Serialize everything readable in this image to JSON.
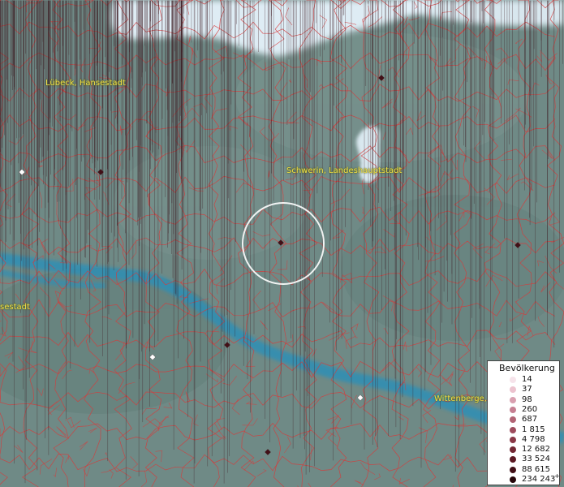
{
  "map": {
    "colors": {
      "land": "#6f8a86",
      "water": "#2f8fb5",
      "ice": "#e4f2fa",
      "boundary": "#d83a3a",
      "focus_ring": "#ffffff"
    },
    "labels": [
      {
        "id": "luebeck",
        "text": "Lübeck, Hansestadt"
      },
      {
        "id": "schwerin",
        "text": "Schwerin, Landeshauptstadt"
      },
      {
        "id": "hansestadt-left",
        "text": "sestadt"
      },
      {
        "id": "wittenberge",
        "text": "Wittenberge,"
      }
    ],
    "legend": {
      "title": "Bevölkerung",
      "entries": [
        {
          "value": "14",
          "color": "#f6e3ea"
        },
        {
          "value": "37",
          "color": "#ecc3cf"
        },
        {
          "value": "98",
          "color": "#d9a0b0"
        },
        {
          "value": "260",
          "color": "#c67f92"
        },
        {
          "value": "687",
          "color": "#b26475"
        },
        {
          "value": "1 815",
          "color": "#9e4c5d"
        },
        {
          "value": "4 798",
          "color": "#8a3847"
        },
        {
          "value": "12 682",
          "color": "#732834"
        },
        {
          "value": "33 524",
          "color": "#5c1a24"
        },
        {
          "value": "88 615",
          "color": "#421017"
        },
        {
          "value": "234 243",
          "color": "#260609",
          "suffix": "+"
        }
      ]
    }
  }
}
